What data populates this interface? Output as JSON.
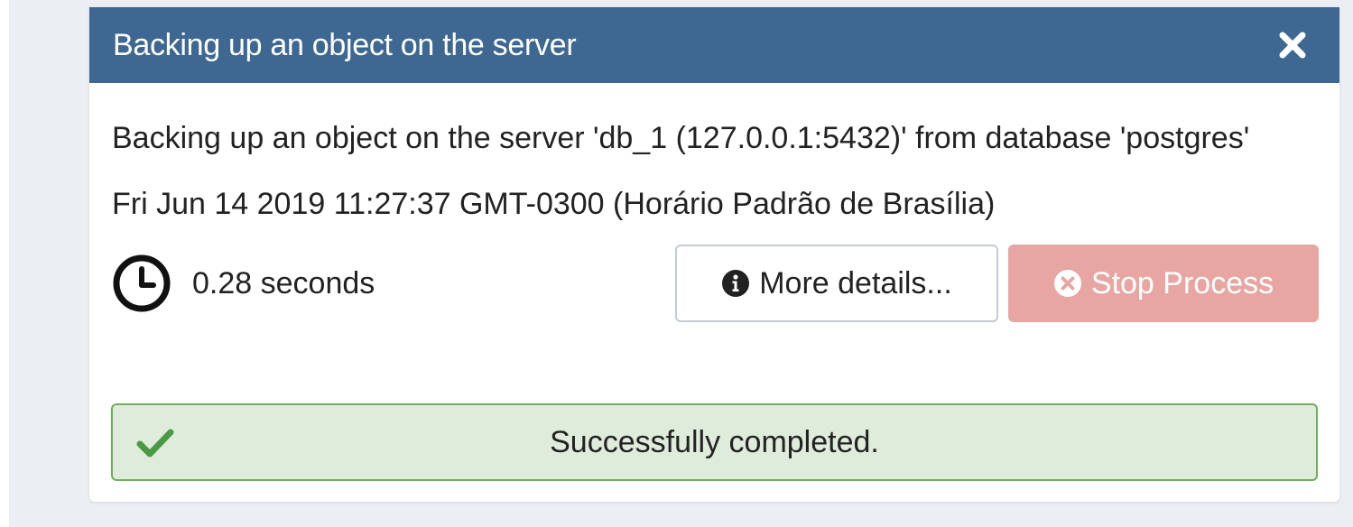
{
  "dialog": {
    "title": "Backing up an object on the server",
    "close_icon": "close-icon",
    "header_color": "#3e6891"
  },
  "body": {
    "description": "Backing up an object on the server 'db_1 (127.0.0.1:5432)' from database 'postgres'",
    "timestamp": "Fri Jun 14 2019 11:27:37 GMT-0300 (Horário Padrão de Brasília)"
  },
  "timer": {
    "icon": "clock-icon",
    "elapsed": "0.28 seconds"
  },
  "buttons": {
    "details_label": "More details...",
    "details_icon": "info-circle-icon",
    "stop_label": "Stop Process",
    "stop_icon": "times-circle-icon",
    "stop_color": "#e8a6a3"
  },
  "status": {
    "icon": "checkmark-icon",
    "message": "Successfully completed.",
    "color": "#6fae5f",
    "background": "#e0ecdb"
  }
}
